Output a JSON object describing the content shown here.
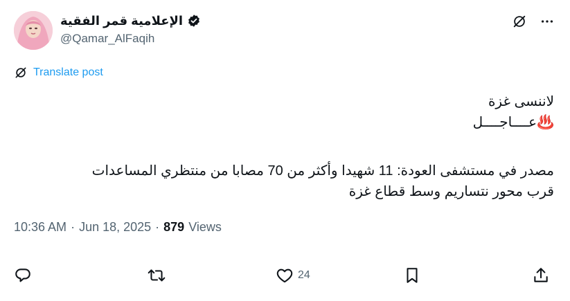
{
  "author": {
    "name": "الإعلامية قمر الفقية",
    "handle": "@Qamar_AlFaqih"
  },
  "translate_label": "Translate post",
  "post": {
    "line1": "لاننسى غزة",
    "line2": "♨️عــــاجــــل",
    "line3": "مصدر في مستشفى العودة: 11 شهيدا وأكثر من 70 مصابا من منتظري المساعدات",
    "line4": "قرب محور نتساريم وسط قطاع غزة"
  },
  "meta": {
    "time": "10:36 AM",
    "sep1": "·",
    "date": "Jun 18, 2025",
    "sep2": "·",
    "views_count": "879",
    "views_label": "Views"
  },
  "actions": {
    "like_count": "24"
  },
  "icons": {
    "grok": "grok-icon",
    "more": "more-icon",
    "verified": "verified-badge-icon",
    "reply": "reply-icon",
    "repost": "repost-icon",
    "like": "heart-icon",
    "bookmark": "bookmark-icon",
    "share": "share-icon"
  },
  "colors": {
    "link": "#1d9bf0",
    "secondary_text": "#536471",
    "primary_text": "#0f1419"
  }
}
